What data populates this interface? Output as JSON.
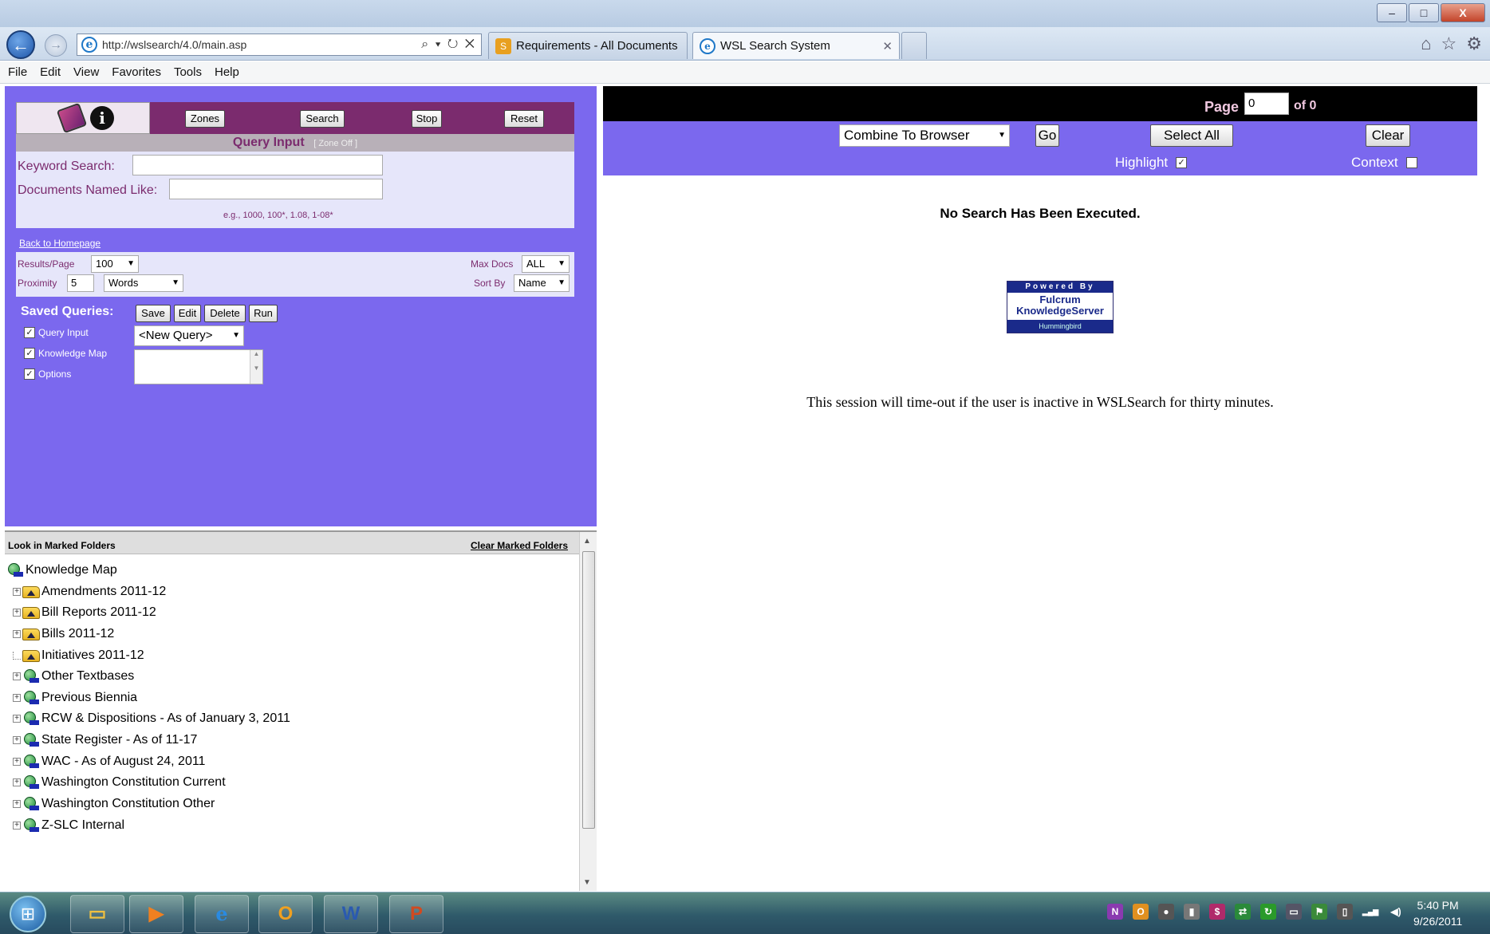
{
  "browser": {
    "address": "http://wslsearch/4.0/main.asp",
    "address_tools": "⌕ ▾ ↻ ✕",
    "tabs": [
      {
        "label": "Requirements - All Documents"
      },
      {
        "label": "WSL Search System"
      }
    ],
    "tab_close": "✕",
    "window_controls": {
      "minimize": "–",
      "maximize": "□",
      "close": "X"
    },
    "toolbar_icons": {
      "home": "⌂",
      "favorites": "☆",
      "settings": "⚙"
    }
  },
  "menu": [
    "File",
    "Edit",
    "View",
    "Favorites",
    "Tools",
    "Help"
  ],
  "toolbar": {
    "zones": "Zones",
    "search": "Search",
    "stop": "Stop",
    "reset": "Reset",
    "info_glyph": "i"
  },
  "query_input": {
    "title": "Query Input",
    "zone_status": "[ Zone Off ]",
    "keyword_label": "Keyword Search:",
    "keyword_value": "",
    "docname_label": "Documents Named Like:",
    "docname_value": "",
    "example": "e.g., 1000, 100*, 1.08, 1-08*"
  },
  "back_to_homepage": "Back to Homepage",
  "options": {
    "results_per_page_label": "Results/Page",
    "results_per_page": "100",
    "proximity_label": "Proximity",
    "proximity_value": "5",
    "proximity_unit": "Words",
    "max_docs_label": "Max Docs",
    "max_docs": "ALL",
    "sort_by_label": "Sort By",
    "sort_by": "Name"
  },
  "saved_queries": {
    "label": "Saved Queries:",
    "save": "Save",
    "edit": "Edit",
    "delete": "Delete",
    "run": "Run",
    "checkboxes": [
      {
        "label": "Query Input",
        "checked": true
      },
      {
        "label": "Knowledge Map",
        "checked": true
      },
      {
        "label": "Options",
        "checked": true
      }
    ],
    "check_glyph": "✓",
    "selected_query": "<New Query>"
  },
  "knowledge_map": {
    "look_label": "Look in Marked Folders",
    "clear_label": "Clear Marked Folders",
    "root": "Knowledge Map",
    "items": [
      {
        "label": "Amendments 2011-12",
        "icon": "folder",
        "expandable": true
      },
      {
        "label": "Bill Reports 2011-12",
        "icon": "folder",
        "expandable": true
      },
      {
        "label": "Bills 2011-12",
        "icon": "folder",
        "expandable": true
      },
      {
        "label": "Initiatives 2011-12",
        "icon": "folder",
        "expandable": false
      },
      {
        "label": "Other Textbases",
        "icon": "globe",
        "expandable": true
      },
      {
        "label": "Previous Biennia",
        "icon": "globe",
        "expandable": true
      },
      {
        "label": "RCW & Dispositions - As of January 3, 2011",
        "icon": "globe",
        "expandable": true
      },
      {
        "label": "State Register - As of 11-17",
        "icon": "globe",
        "expandable": true
      },
      {
        "label": "WAC - As of August 24, 2011",
        "icon": "globe",
        "expandable": true
      },
      {
        "label": "Washington Constitution Current",
        "icon": "globe",
        "expandable": true
      },
      {
        "label": "Washington Constitution Other",
        "icon": "globe",
        "expandable": true
      },
      {
        "label": "Z-SLC Internal",
        "icon": "globe",
        "expandable": true
      }
    ],
    "expander_glyph": "+",
    "scroll_up": "▲",
    "scroll_down": "▼"
  },
  "results": {
    "page_label": "Page",
    "page_value": "0",
    "of_label": "of 0",
    "combine_option": "Combine To Browser",
    "go": "Go",
    "select_all": "Select All",
    "clear": "Clear",
    "highlight_label": "Highlight",
    "highlight_checked": true,
    "context_label": "Context",
    "context_checked": false,
    "no_search_msg": "No Search Has Been Executed.",
    "powered_by": "Powered By",
    "fulcrum": "Fulcrum",
    "knowledge_server": "KnowledgeServer",
    "hummingbird": "Hummingbird",
    "timeout_msg": "This session will time-out if the user is inactive in WSLSearch for thirty minutes."
  },
  "taskbar": {
    "start_glyph": "⊞",
    "items": [
      {
        "name": "explorer",
        "glyph": "▭",
        "color": "#f0c040"
      },
      {
        "name": "media-player",
        "glyph": "▶",
        "color": "#f08020"
      },
      {
        "name": "internet-explorer",
        "glyph": "e",
        "color": "#2a8ae0"
      },
      {
        "name": "outlook",
        "glyph": "O",
        "color": "#f0a020"
      },
      {
        "name": "word",
        "glyph": "W",
        "color": "#2a5ab0"
      },
      {
        "name": "powerpoint",
        "glyph": "P",
        "color": "#d04a20"
      }
    ],
    "tray": [
      {
        "name": "onenote-icon",
        "glyph": "N",
        "color": "#8a3ab0"
      },
      {
        "name": "outlook-tray-icon",
        "glyph": "O",
        "color": "#e09020"
      },
      {
        "name": "tray-app-icon",
        "glyph": "●",
        "color": "#555"
      },
      {
        "name": "tray-flag-icon",
        "glyph": "▮",
        "color": "#777"
      },
      {
        "name": "tray-s-icon",
        "glyph": "$",
        "color": "#b02a6a"
      },
      {
        "name": "tray-sync-icon",
        "glyph": "⇄",
        "color": "#2a8a3a"
      },
      {
        "name": "tray-refresh-icon",
        "glyph": "↻",
        "color": "#2a9a2a"
      },
      {
        "name": "tray-monitor-icon",
        "glyph": "▭",
        "color": "#556"
      },
      {
        "name": "tray-security-icon",
        "glyph": "⚑",
        "color": "#3a8a3a"
      },
      {
        "name": "tray-power-icon",
        "glyph": "▯",
        "color": "#555"
      },
      {
        "name": "network-icon",
        "glyph": "▂▄▆",
        "color": "#555"
      },
      {
        "name": "volume-icon",
        "glyph": "◀)",
        "color": "#555"
      }
    ],
    "time": "5:40 PM",
    "date": "9/26/2011"
  }
}
